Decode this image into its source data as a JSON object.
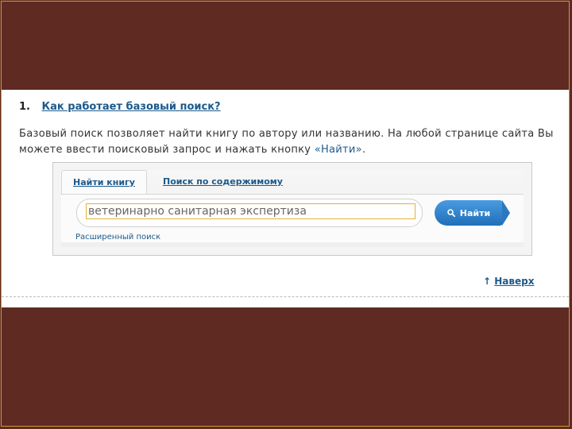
{
  "faq": {
    "number": "1.",
    "question": "Как работает базовый поиск?",
    "desc_part1": "Базовый поиск позволяет найти книгу по автору или названию. На любой странице сайта Вы можете ввести поисковый запрос и нажать кнопку ",
    "desc_highlight": "«Найти»",
    "desc_end": "."
  },
  "search": {
    "tab_active": "Найти книгу",
    "tab_other": "Поиск по содержимому",
    "input_value": "ветеринарно санитарная экспертиза",
    "button_label": "Найти",
    "advanced_link": "Расширенный поиск"
  },
  "footer": {
    "arrow": "↑",
    "to_top": "Наверх"
  },
  "colors": {
    "background": "#5e2a22",
    "link": "#1c5a8c",
    "button": "#1f6fb9"
  }
}
